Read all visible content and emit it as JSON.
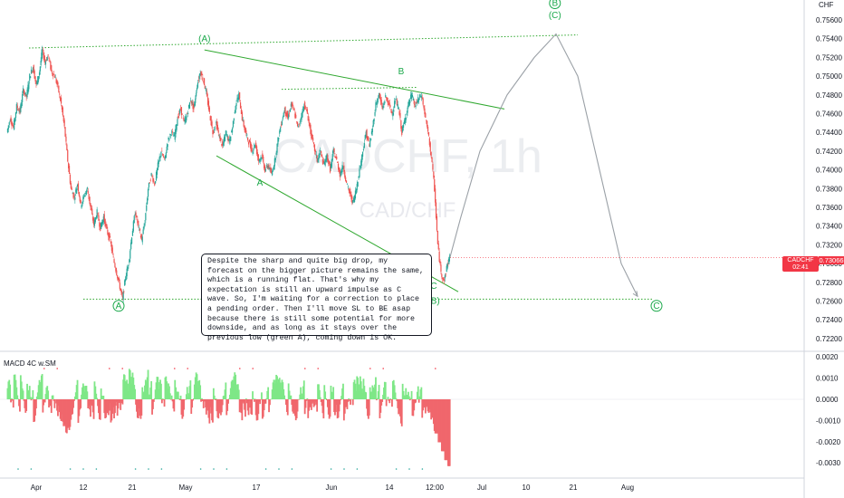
{
  "chart_data": [
    {
      "type": "line",
      "symbol": "CADCHF",
      "watermark": {
        "symbol": "CADCHF, 1h",
        "pair": "CAD/CHF"
      },
      "currency_label": "CHF",
      "price_axis": {
        "min": 0.722,
        "max": 0.757,
        "ticks": [
          "0.75600",
          "0.75400",
          "0.75200",
          "0.75000",
          "0.74800",
          "0.74600",
          "0.74400",
          "0.74200",
          "0.74000",
          "0.73800",
          "0.73600",
          "0.73400",
          "0.73200",
          "0.73000",
          "0.72800",
          "0.72600",
          "0.72400",
          "0.72200"
        ]
      },
      "time_axis": {
        "labels": [
          "Apr",
          "12",
          "21",
          "May",
          "17",
          "Jun",
          "14",
          "12:00",
          "Jul",
          "10",
          "21",
          "Aug"
        ]
      },
      "last_price": {
        "value": "0.73066",
        "countdown": "02:41",
        "symbol": "CADCHF"
      },
      "price_path": [
        [
          0,
          0.744
        ],
        [
          0.6,
          0.7455
        ],
        [
          1.2,
          0.7445
        ],
        [
          1.8,
          0.7468
        ],
        [
          2.4,
          0.7462
        ],
        [
          3.0,
          0.7485
        ],
        [
          3.6,
          0.7478
        ],
        [
          4.2,
          0.75
        ],
        [
          4.8,
          0.751
        ],
        [
          5.4,
          0.749
        ],
        [
          6.0,
          0.7505
        ],
        [
          6.5,
          0.7528
        ],
        [
          7.0,
          0.7515
        ],
        [
          7.6,
          0.7522
        ],
        [
          8.2,
          0.7505
        ],
        [
          8.8,
          0.75
        ],
        [
          9.4,
          0.7488
        ],
        [
          10.0,
          0.747
        ],
        [
          10.6,
          0.7445
        ],
        [
          11.2,
          0.741
        ],
        [
          11.8,
          0.738
        ],
        [
          12.4,
          0.737
        ],
        [
          13.0,
          0.7385
        ],
        [
          13.6,
          0.7362
        ],
        [
          14.2,
          0.7372
        ],
        [
          14.8,
          0.738
        ],
        [
          15.4,
          0.736
        ],
        [
          16.0,
          0.7342
        ],
        [
          16.6,
          0.7355
        ],
        [
          17.2,
          0.7338
        ],
        [
          17.8,
          0.735
        ],
        [
          18.4,
          0.7335
        ],
        [
          19.0,
          0.7325
        ],
        [
          19.6,
          0.7305
        ],
        [
          20.2,
          0.729
        ],
        [
          20.8,
          0.7275
        ],
        [
          21.3,
          0.7262
        ],
        [
          21.8,
          0.7285
        ],
        [
          22.4,
          0.73
        ],
        [
          23.0,
          0.733
        ],
        [
          23.6,
          0.7355
        ],
        [
          24.2,
          0.734
        ],
        [
          24.8,
          0.7325
        ],
        [
          25.4,
          0.7345
        ],
        [
          26.0,
          0.738
        ],
        [
          26.6,
          0.7395
        ],
        [
          27.2,
          0.7385
        ],
        [
          27.8,
          0.7405
        ],
        [
          28.4,
          0.742
        ],
        [
          29.0,
          0.741
        ],
        [
          29.6,
          0.743
        ],
        [
          30.2,
          0.744
        ],
        [
          30.8,
          0.7435
        ],
        [
          31.4,
          0.7455
        ],
        [
          32.0,
          0.7465
        ],
        [
          32.6,
          0.745
        ],
        [
          33.2,
          0.746
        ],
        [
          33.8,
          0.7475
        ],
        [
          34.4,
          0.7465
        ],
        [
          35.0,
          0.749
        ],
        [
          35.6,
          0.7505
        ],
        [
          36.2,
          0.7495
        ],
        [
          36.7,
          0.7482
        ],
        [
          37.3,
          0.746
        ],
        [
          37.9,
          0.744
        ],
        [
          38.5,
          0.745
        ],
        [
          39.1,
          0.7435
        ],
        [
          39.7,
          0.7425
        ],
        [
          40.3,
          0.744
        ],
        [
          40.9,
          0.743
        ],
        [
          41.5,
          0.7445
        ],
        [
          42.1,
          0.747
        ],
        [
          42.7,
          0.748
        ],
        [
          43.3,
          0.7455
        ],
        [
          43.9,
          0.744
        ],
        [
          44.5,
          0.743
        ],
        [
          45.1,
          0.742
        ],
        [
          45.7,
          0.7428
        ],
        [
          46.3,
          0.741
        ],
        [
          46.9,
          0.7415
        ],
        [
          47.5,
          0.74
        ],
        [
          48.1,
          0.7405
        ],
        [
          48.7,
          0.7395
        ],
        [
          49.3,
          0.741
        ],
        [
          49.9,
          0.7432
        ],
        [
          50.5,
          0.745
        ],
        [
          51.1,
          0.7465
        ],
        [
          51.7,
          0.7455
        ],
        [
          52.3,
          0.747
        ],
        [
          52.9,
          0.7462
        ],
        [
          53.5,
          0.7445
        ],
        [
          54.1,
          0.7455
        ],
        [
          54.7,
          0.747
        ],
        [
          55.3,
          0.746
        ],
        [
          55.9,
          0.744
        ],
        [
          56.5,
          0.7425
        ],
        [
          57.1,
          0.741
        ],
        [
          57.7,
          0.742
        ],
        [
          58.3,
          0.7405
        ],
        [
          58.9,
          0.7415
        ],
        [
          59.5,
          0.74
        ],
        [
          60.1,
          0.742
        ],
        [
          60.7,
          0.741
        ],
        [
          61.3,
          0.7395
        ],
        [
          61.9,
          0.7405
        ],
        [
          62.5,
          0.7385
        ],
        [
          63.1,
          0.7375
        ],
        [
          63.7,
          0.7365
        ],
        [
          64.3,
          0.738
        ],
        [
          64.9,
          0.74
        ],
        [
          65.5,
          0.742
        ],
        [
          66.1,
          0.744
        ],
        [
          66.7,
          0.7425
        ],
        [
          67.3,
          0.7445
        ],
        [
          67.9,
          0.747
        ],
        [
          68.5,
          0.748
        ],
        [
          69.1,
          0.7465
        ],
        [
          69.7,
          0.7478
        ],
        [
          70.3,
          0.747
        ],
        [
          70.9,
          0.746
        ],
        [
          71.5,
          0.7475
        ],
        [
          72.1,
          0.7465
        ],
        [
          72.7,
          0.744
        ],
        [
          73.3,
          0.7455
        ],
        [
          73.9,
          0.747
        ],
        [
          74.5,
          0.748
        ],
        [
          75.1,
          0.7468
        ],
        [
          75.7,
          0.7475
        ],
        [
          76.3,
          0.748
        ],
        [
          76.9,
          0.746
        ],
        [
          77.5,
          0.744
        ],
        [
          78.1,
          0.7415
        ],
        [
          78.7,
          0.738
        ],
        [
          79.3,
          0.732
        ],
        [
          79.9,
          0.729
        ],
        [
          80.5,
          0.7282
        ],
        [
          81.1,
          0.73
        ],
        [
          81.5,
          0.7307
        ]
      ],
      "forecast_path": [
        [
          81.5,
          0.7307
        ],
        [
          83.5,
          0.735
        ],
        [
          87,
          0.742
        ],
        [
          92,
          0.748
        ],
        [
          97,
          0.752
        ],
        [
          101,
          0.7545
        ],
        [
          105,
          0.75
        ],
        [
          109,
          0.74
        ],
        [
          113,
          0.73
        ],
        [
          116,
          0.7265
        ]
      ],
      "waves": [
        {
          "label": "A",
          "circled": true,
          "x": 20.5,
          "y": 0.7252
        },
        {
          "label": "(A)",
          "circled": false,
          "x": 36.3,
          "y": 0.7537
        },
        {
          "label": "A",
          "circled": false,
          "x": 46.5,
          "y": 0.7383
        },
        {
          "label": "B",
          "circled": false,
          "x": 72.5,
          "y": 0.7502
        },
        {
          "label": "C",
          "circled": false,
          "x": 78.5,
          "y": 0.7273
        },
        {
          "label": "(B)",
          "circled": false,
          "x": 78.5,
          "y": 0.7257
        },
        {
          "label": "(C)",
          "circled": false,
          "x": 100.8,
          "y": 0.7562
        },
        {
          "label": "B",
          "circled": true,
          "x": 100.8,
          "y": 0.7575
        },
        {
          "label": "C",
          "circled": true,
          "x": 119.5,
          "y": 0.7252
        }
      ],
      "trendlines": [
        {
          "style": "dotted",
          "from": [
            4,
            0.753
          ],
          "to": [
            105,
            0.7544
          ]
        },
        {
          "style": "dotted",
          "from": [
            50.5,
            0.7486
          ],
          "to": [
            75.5,
            0.7488
          ]
        },
        {
          "style": "dotted",
          "from": [
            14,
            0.7262
          ],
          "to": [
            119,
            0.7262
          ]
        },
        {
          "style": "solid",
          "from": [
            36.3,
            0.7528
          ],
          "to": [
            91.5,
            0.7465
          ]
        },
        {
          "style": "solid",
          "from": [
            38.5,
            0.7415
          ],
          "to": [
            83,
            0.727
          ]
        }
      ],
      "annotation": "Despite the sharp and quite big drop, my forecast on the bigger picture remains the same, which is a running flat. That's why my expectation is still an upward impulse as C wave. So, I'm waiting for a correction to place a pending order. Then I'll move SL to BE asap because there is still some potential for more downside, and as long as it stays over the previous low (green A), coming down is OK."
    },
    {
      "type": "bar",
      "title": "MACD 4C w.SM",
      "ylim": [
        -0.0036,
        0.0024
      ],
      "ticks": [
        "0.0020",
        "0.0010",
        "0.0000",
        "-0.0010",
        "-0.0020",
        "-0.0030"
      ],
      "colors": {
        "up": "#7ee787",
        "down": "#f0676c"
      }
    }
  ],
  "colors": {
    "up": "#26a69a",
    "down": "#ef5350",
    "wave": "#1aa84a",
    "trend": "#2fa82f",
    "forecast": "#9aa0a6",
    "badge": "#f23645"
  }
}
